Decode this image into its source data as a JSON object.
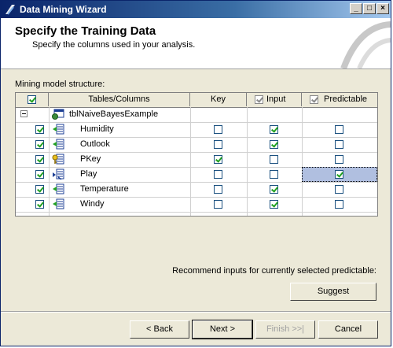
{
  "window": {
    "title": "Data Mining Wizard"
  },
  "header": {
    "title": "Specify the Training Data",
    "subtitle": "Specify the columns used in your analysis."
  },
  "grid": {
    "label": "Mining model structure:",
    "columns": {
      "tables": "Tables/Columns",
      "key": "Key",
      "input": "Input",
      "predictable": "Predictable"
    },
    "table_name": "tblNaiveBayesExample",
    "rows": [
      {
        "name": "Humidity",
        "include": true,
        "key": false,
        "input": true,
        "predictable": false
      },
      {
        "name": "Outlook",
        "include": true,
        "key": false,
        "input": true,
        "predictable": false
      },
      {
        "name": "PKey",
        "include": true,
        "key": true,
        "input": false,
        "predictable": false
      },
      {
        "name": "Play",
        "include": true,
        "key": false,
        "input": false,
        "predictable": true
      },
      {
        "name": "Temperature",
        "include": true,
        "key": false,
        "input": true,
        "predictable": false
      },
      {
        "name": "Windy",
        "include": true,
        "key": false,
        "input": true,
        "predictable": false
      }
    ]
  },
  "recommend": {
    "text": "Recommend inputs for currently selected predictable:",
    "suggest_label": "Suggest"
  },
  "buttons": {
    "back": "< Back",
    "next": "Next >",
    "finish": "Finish >>|",
    "cancel": "Cancel"
  }
}
